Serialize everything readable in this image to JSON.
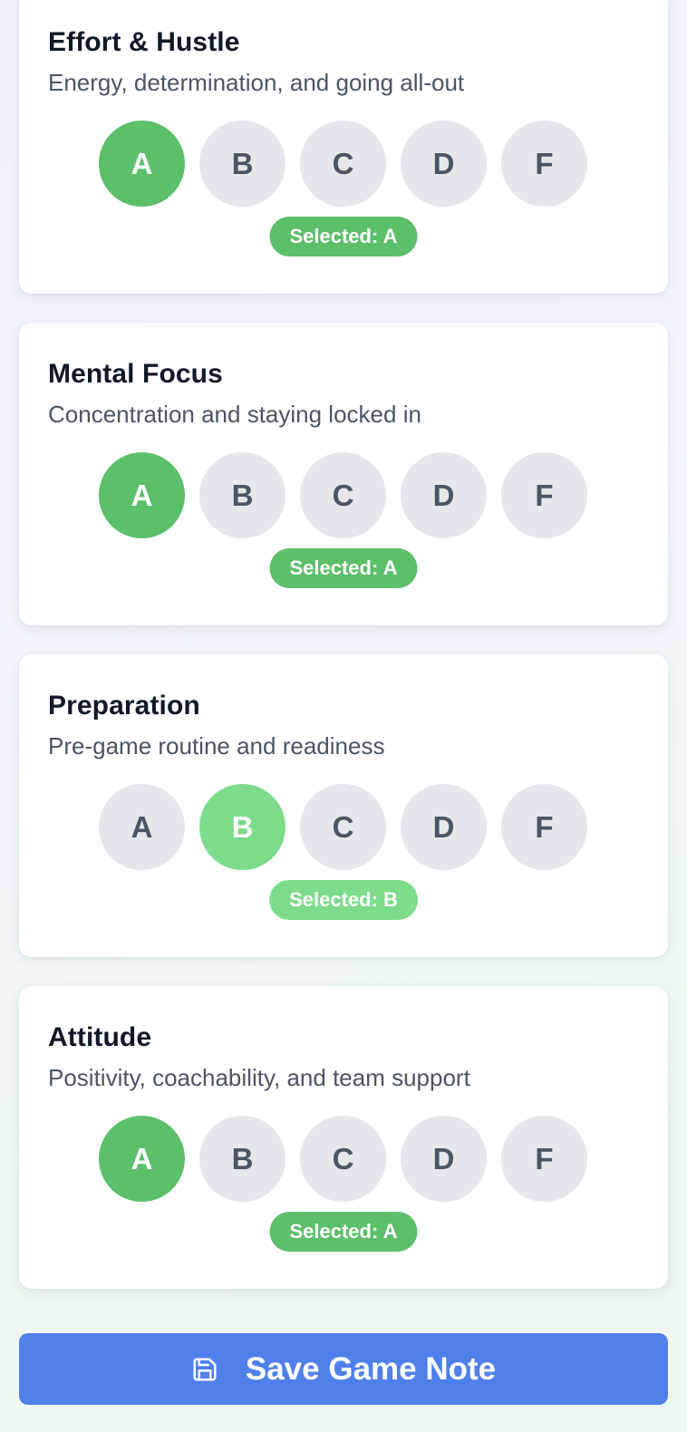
{
  "cards": [
    {
      "title": "Effort & Hustle",
      "description": "Energy, determination, and going all-out",
      "grades": [
        "A",
        "B",
        "C",
        "D",
        "F"
      ],
      "selected": "A",
      "selected_text": "Selected: A"
    },
    {
      "title": "Mental Focus",
      "description": "Concentration and staying locked in",
      "grades": [
        "A",
        "B",
        "C",
        "D",
        "F"
      ],
      "selected": "A",
      "selected_text": "Selected: A"
    },
    {
      "title": "Preparation",
      "description": "Pre-game routine and readiness",
      "grades": [
        "A",
        "B",
        "C",
        "D",
        "F"
      ],
      "selected": "B",
      "selected_text": "Selected: B"
    },
    {
      "title": "Attitude",
      "description": "Positivity, coachability, and team support",
      "grades": [
        "A",
        "B",
        "C",
        "D",
        "F"
      ],
      "selected": "A",
      "selected_text": "Selected: A"
    }
  ],
  "save_button": {
    "label": "Save Game Note",
    "icon": "save-icon"
  },
  "colors": {
    "grade_a_selected": "#5cbf6a",
    "grade_b_selected": "#7ddc8b",
    "grade_unselected": "#e5e7eb",
    "save_button": "#4f80ea"
  }
}
